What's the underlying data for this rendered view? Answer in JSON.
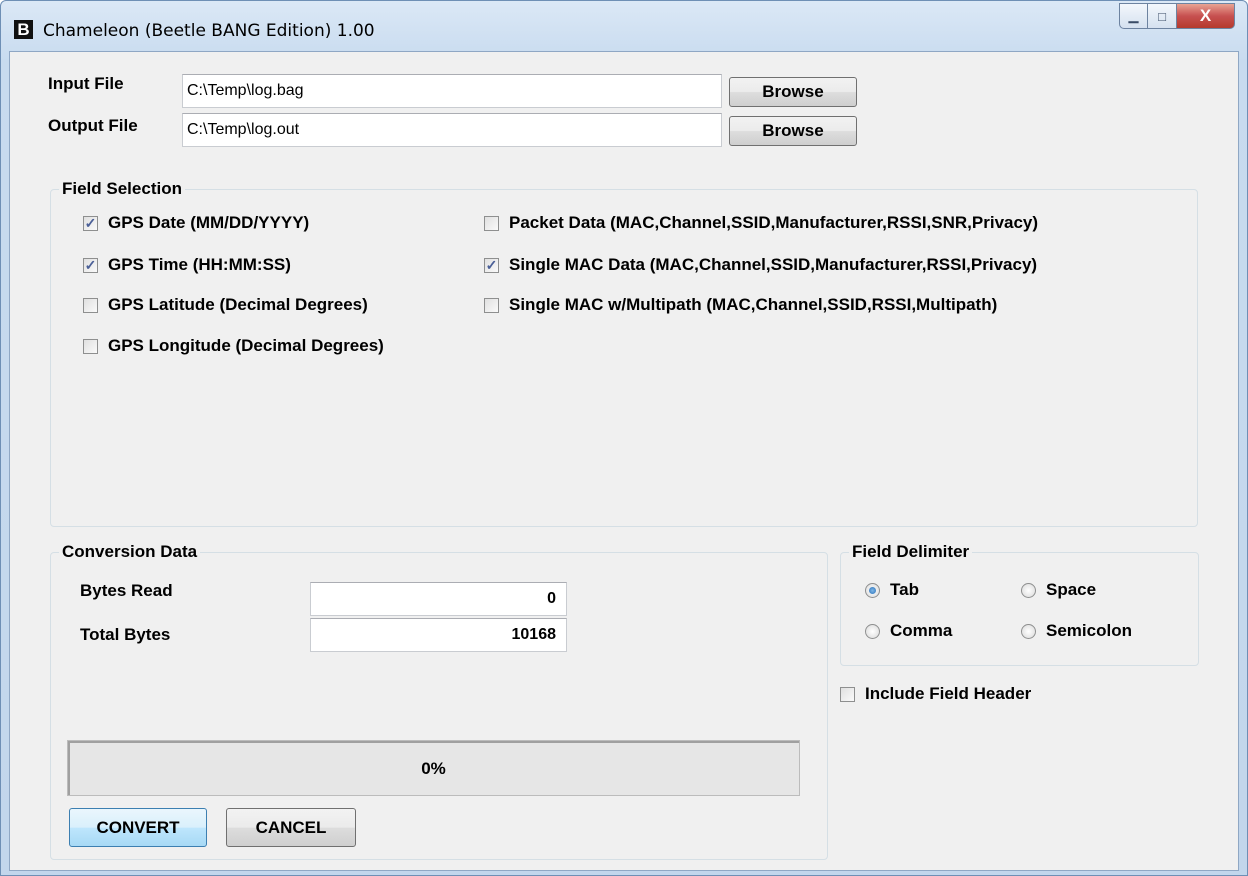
{
  "window": {
    "title": "Chameleon (Beetle BANG Edition) 1.00",
    "icon_letter": "B",
    "icon": "app-b-icon",
    "min_glyph": "▁",
    "max_glyph": "□",
    "close_glyph": "X"
  },
  "files": {
    "input_label": "Input File",
    "input_value": "C:\\Temp\\log.bag",
    "output_label": "Output File",
    "output_value": "C:\\Temp\\log.out",
    "browse_label": "Browse"
  },
  "field_selection": {
    "title": "Field Selection",
    "items": [
      {
        "label": "GPS Date (MM/DD/YYYY)",
        "checked": true
      },
      {
        "label": "GPS Time (HH:MM:SS)",
        "checked": true
      },
      {
        "label": "GPS Latitude (Decimal Degrees)",
        "checked": false
      },
      {
        "label": "GPS Longitude (Decimal Degrees)",
        "checked": false
      },
      {
        "label": "Packet Data (MAC,Channel,SSID,Manufacturer,RSSI,SNR,Privacy)",
        "checked": false
      },
      {
        "label": "Single MAC Data (MAC,Channel,SSID,Manufacturer,RSSI,Privacy)",
        "checked": true
      },
      {
        "label": "Single MAC w/Multipath (MAC,Channel,SSID,RSSI,Multipath)",
        "checked": false
      }
    ]
  },
  "conversion": {
    "title": "Conversion Data",
    "bytes_read_label": "Bytes Read",
    "bytes_read_value": "0",
    "total_bytes_label": "Total Bytes",
    "total_bytes_value": "10168",
    "progress_percent": 0,
    "progress_text": "0%",
    "convert_label": "CONVERT",
    "cancel_label": "CANCEL"
  },
  "delimiter": {
    "title": "Field Delimiter",
    "options": [
      {
        "label": "Tab",
        "selected": true
      },
      {
        "label": "Space",
        "selected": false
      },
      {
        "label": "Comma",
        "selected": false
      },
      {
        "label": "Semicolon",
        "selected": false
      }
    ]
  },
  "include_header": {
    "label": "Include Field Header",
    "checked": false
  },
  "colors": {
    "accent": "#3c7fb1",
    "check": "#4a5f97",
    "close": "#c75050"
  }
}
